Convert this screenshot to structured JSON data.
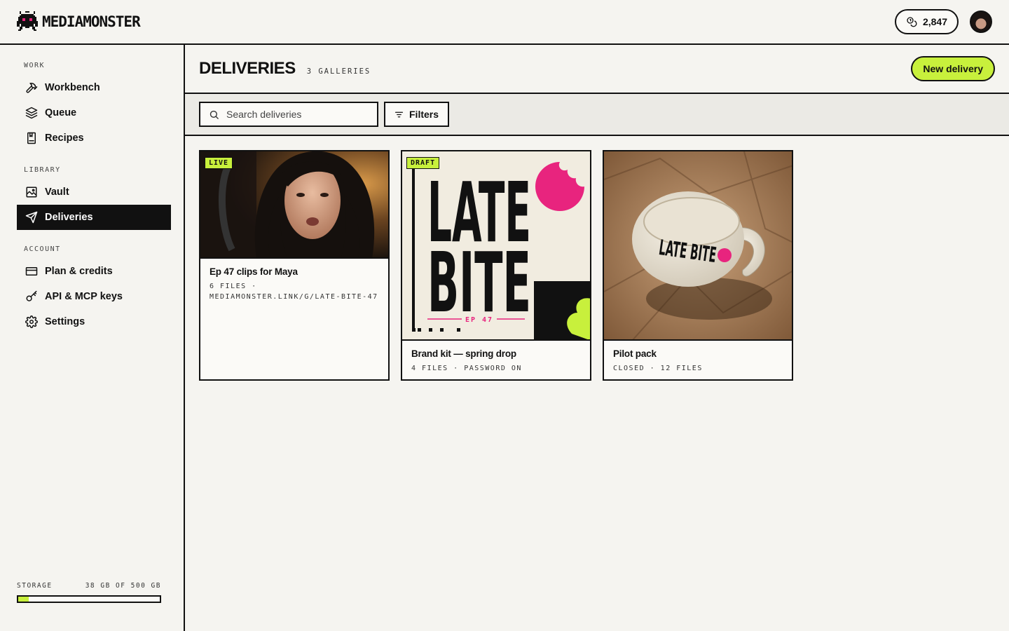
{
  "brand": {
    "name": "MEDIAMONSTER",
    "logo_icon": "pixel-monster-icon"
  },
  "header": {
    "credits": "2,847",
    "credits_icon": "coins-icon"
  },
  "sidebar": {
    "sections": [
      {
        "title": "WORK",
        "items": [
          {
            "label": "Workbench",
            "icon": "hammer-icon"
          },
          {
            "label": "Queue",
            "icon": "layers-icon"
          },
          {
            "label": "Recipes",
            "icon": "book-icon"
          }
        ]
      },
      {
        "title": "LIBRARY",
        "items": [
          {
            "label": "Vault",
            "icon": "image-icon"
          },
          {
            "label": "Deliveries",
            "icon": "send-icon",
            "active": true
          }
        ]
      },
      {
        "title": "ACCOUNT",
        "items": [
          {
            "label": "Plan & credits",
            "icon": "card-icon"
          },
          {
            "label": "API & MCP keys",
            "icon": "key-icon"
          },
          {
            "label": "Settings",
            "icon": "gear-icon"
          }
        ]
      }
    ],
    "storage": {
      "label": "STORAGE",
      "value": "38 GB OF 500 GB",
      "used_fraction": 0.076
    }
  },
  "page": {
    "title": "DELIVERIES",
    "count": "3 GALLERIES",
    "new_button": "New delivery",
    "search_placeholder": "Search deliveries",
    "filters_label": "Filters"
  },
  "cards": [
    {
      "badge": "LIVE",
      "title": "Ep 47 clips for Maya",
      "meta_line1": "6 FILES ·",
      "meta_line2": "MEDIAMONSTER.LINK/G/LATE-BITE-47"
    },
    {
      "badge": "DRAFT",
      "title": "Brand kit — spring drop",
      "meta_line1": "4 FILES · PASSWORD ON",
      "poster_line1": "LATE",
      "poster_line2": "BITE",
      "poster_ep": "EP 47"
    },
    {
      "title": "Pilot pack",
      "meta_line1": "CLOSED · 12 FILES",
      "mug_text": "LATE BITE"
    }
  ],
  "colors": {
    "accent": "#c8f03c",
    "ink": "#111111",
    "background": "#f5f4f0",
    "pink": "#e8247e"
  }
}
